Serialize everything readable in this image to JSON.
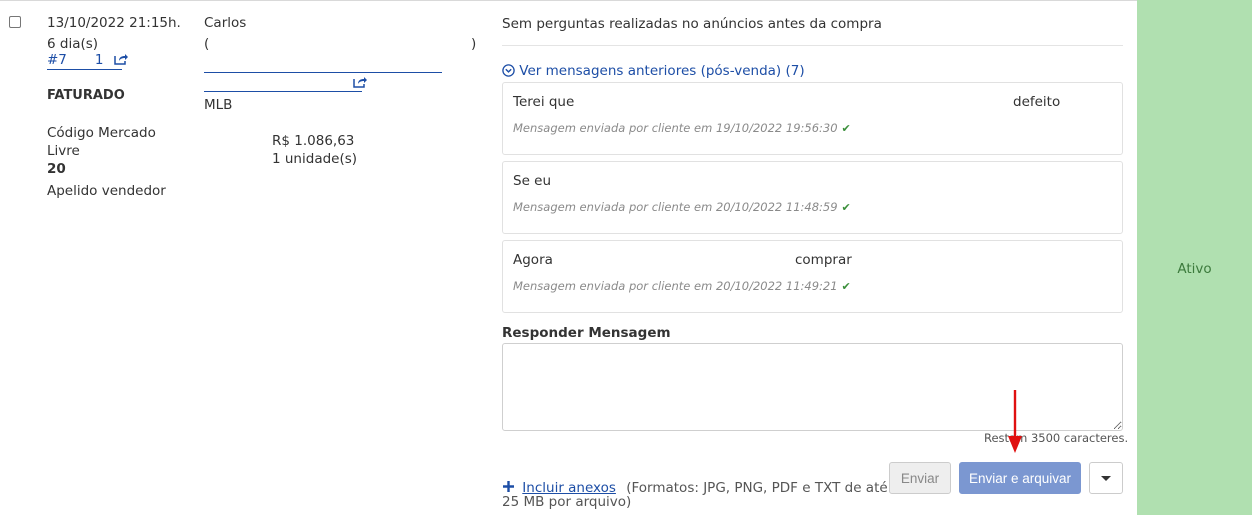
{
  "order": {
    "date": "13/10/2022 21:15h.",
    "days": "6 dia(s)",
    "number_prefix": "#7",
    "number_suffix": "1",
    "status": "FATURADO",
    "code_label": "Código Mercado Livre",
    "code_value": "20",
    "seller_label": "Apelido vendedor"
  },
  "buyer": {
    "name": "Carlos",
    "paren_open": "(",
    "paren_close": ")",
    "listing_prefix": "MLB",
    "price": "R$ 1.086,63",
    "quantity": "1 unidade(s)"
  },
  "messages": {
    "no_questions": "Sem perguntas realizadas no anúncios antes da compra",
    "toggle_label": "Ver mensagens anteriores (pós-venda) (7)",
    "items": [
      {
        "text": "Terei que",
        "text_end": "defeito",
        "meta": "Mensagem enviada por cliente em 19/10/2022 19:56:30"
      },
      {
        "text": "Se eu",
        "text_end": "",
        "meta": "Mensagem enviada por cliente em 20/10/2022 11:48:59"
      },
      {
        "text": "Agora",
        "text_end": "comprar",
        "meta": "Mensagem enviada por cliente em 20/10/2022 11:49:21"
      }
    ]
  },
  "reply": {
    "heading": "Responder Mensagem",
    "textarea_value": "",
    "remaining": "Restam 3500 caracteres.",
    "attach_label": "Incluir anexos",
    "attach_formats": "(Formatos: JPG, PNG, PDF e TXT de até",
    "attach_formats_2": "25 MB por arquivo)",
    "send_label": "Enviar",
    "send_archive_label": "Enviar e arquivar"
  },
  "status": {
    "label": "Ativo"
  },
  "colors": {
    "status_bg": "#b0e0b0",
    "primary_button": "#7b97d1",
    "link": "#1d4ea6",
    "annotation_arrow": "#e01010"
  }
}
